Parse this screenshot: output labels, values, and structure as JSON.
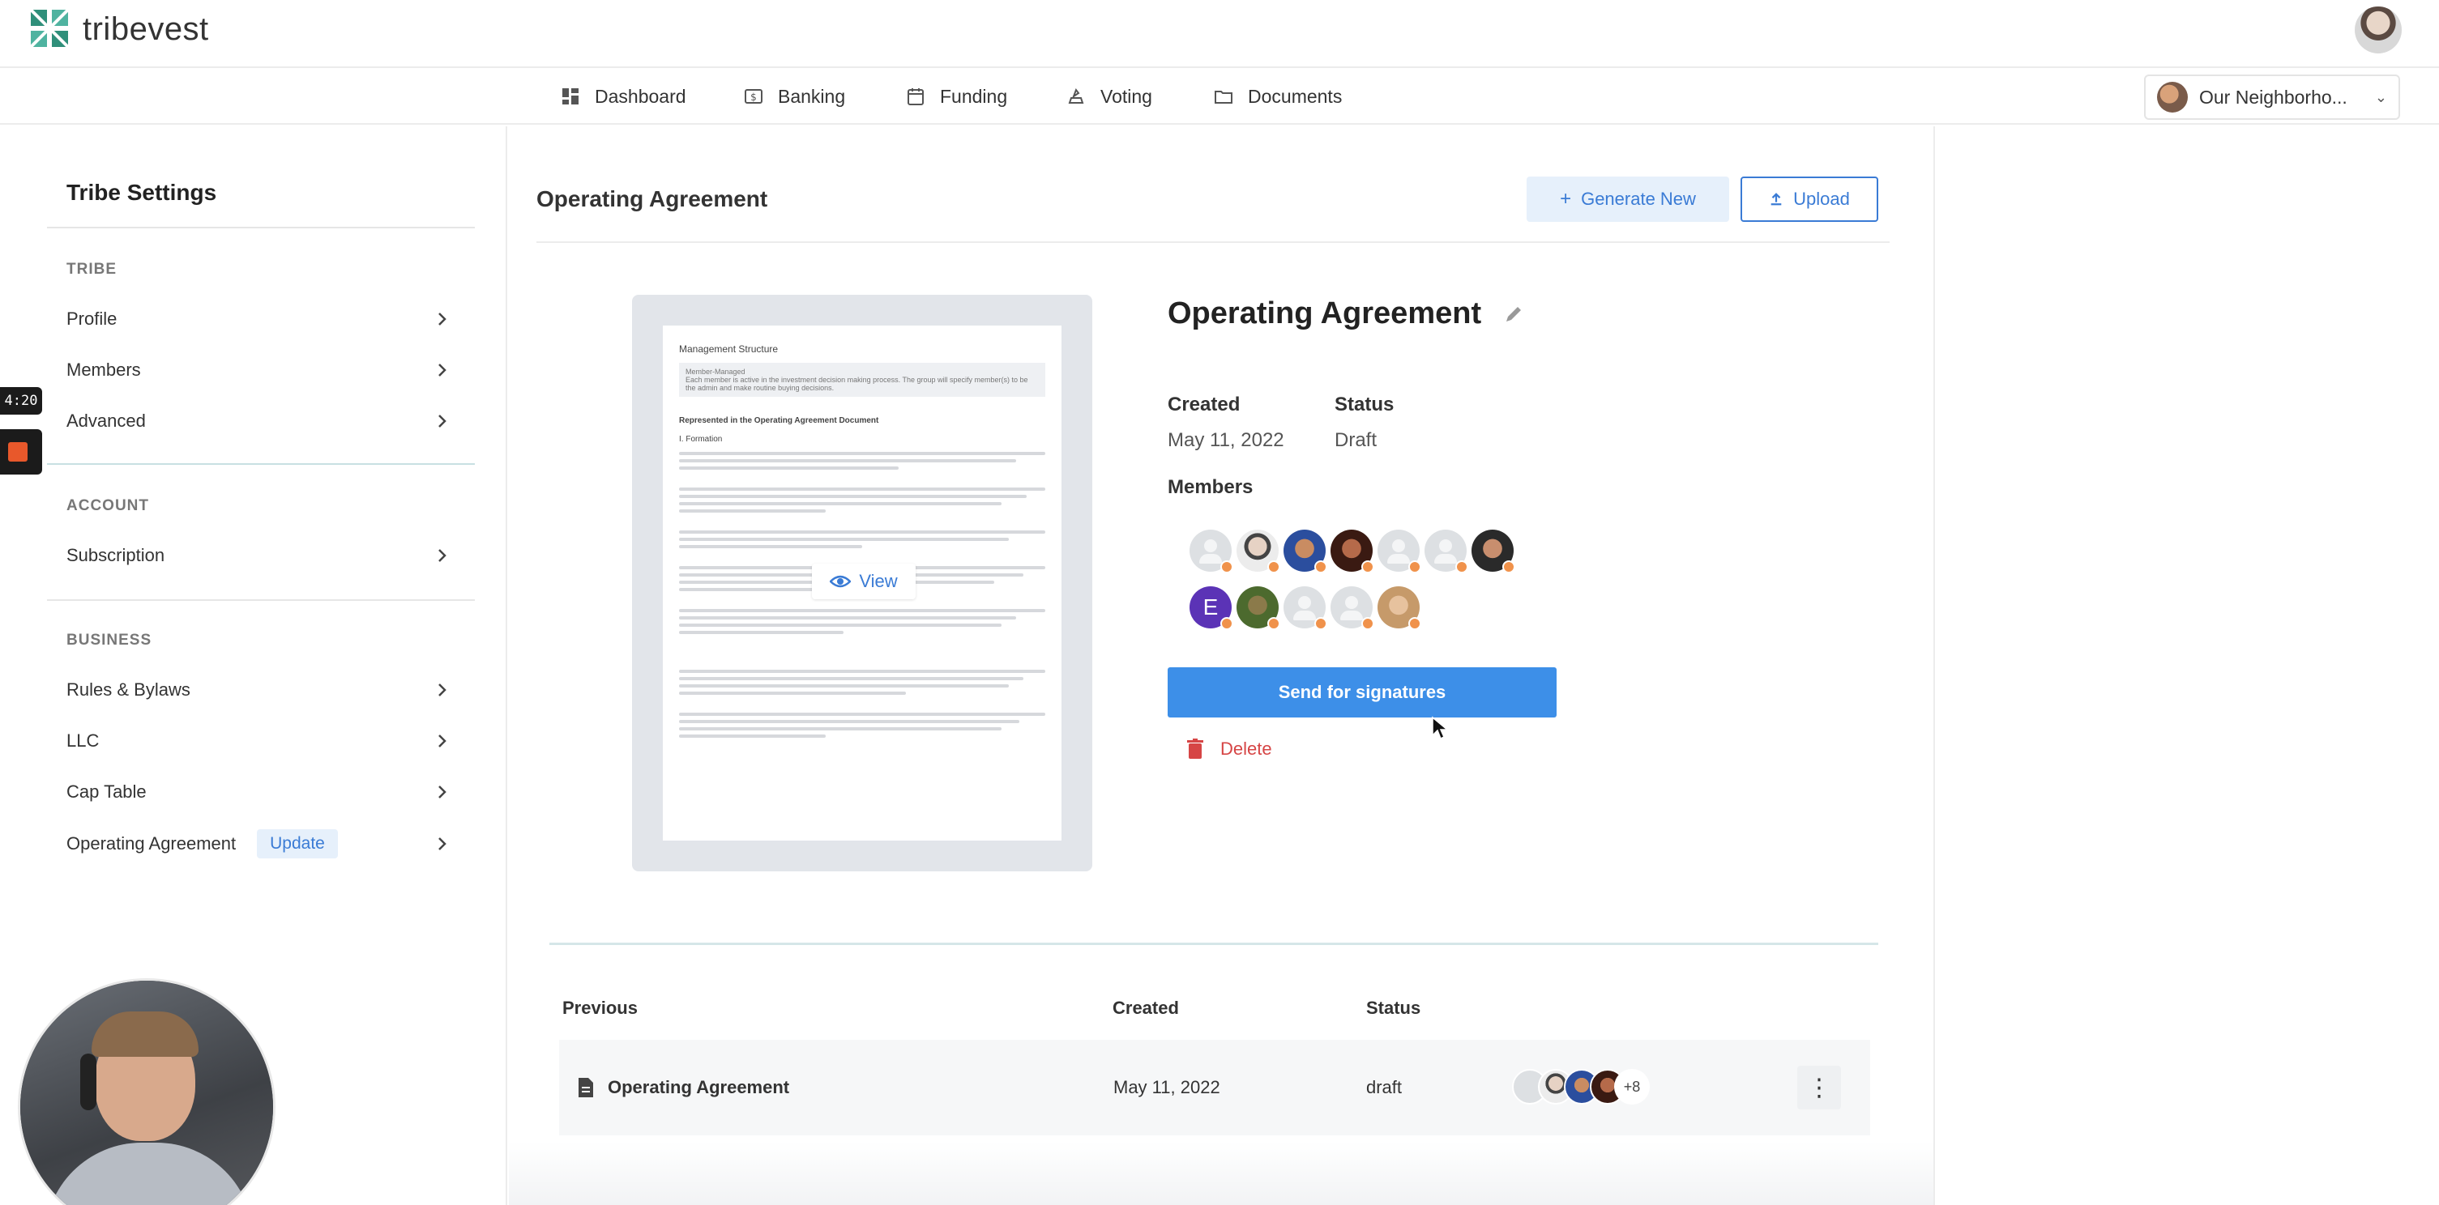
{
  "app": {
    "name": "tribevest",
    "org_selector": "Our Neighborho..."
  },
  "nav": [
    {
      "label": "Dashboard",
      "icon": "dashboard-icon"
    },
    {
      "label": "Banking",
      "icon": "banking-icon"
    },
    {
      "label": "Funding",
      "icon": "funding-icon"
    },
    {
      "label": "Voting",
      "icon": "voting-icon"
    },
    {
      "label": "Documents",
      "icon": "documents-icon"
    }
  ],
  "sidebar": {
    "title": "Tribe Settings",
    "sections": [
      {
        "heading": "TRIBE",
        "items": [
          "Profile",
          "Members",
          "Advanced"
        ]
      },
      {
        "heading": "ACCOUNT",
        "items": [
          "Subscription"
        ]
      },
      {
        "heading": "BUSINESS",
        "items": [
          "Rules & Bylaws",
          "LLC",
          "Cap Table",
          "Operating Agreement"
        ]
      }
    ],
    "update_badge": "Update"
  },
  "recording": {
    "timer": "4:20"
  },
  "main": {
    "title": "Operating Agreement",
    "generate_label": "Generate New",
    "upload_label": "Upload",
    "preview": {
      "heading": "Management Structure",
      "box_title": "Member-Managed",
      "box_text": "Each member is active in the investment decision making process. The group will specify member(s) to be the admin and make routine buying decisions.",
      "subheading": "Represented in the Operating Agreement Document",
      "section": "I. Formation",
      "view_label": "View"
    },
    "detail": {
      "title": "Operating Agreement",
      "created_label": "Created",
      "created_value": "May 11, 2022",
      "status_label": "Status",
      "status_value": "Draft",
      "members_label": "Members",
      "member_letter": "E",
      "send_label": "Send for signatures",
      "delete_label": "Delete"
    },
    "previous": {
      "headers": {
        "name": "Previous",
        "created": "Created",
        "status": "Status"
      },
      "rows": [
        {
          "name": "Operating Agreement",
          "created": "May 11, 2022",
          "status": "draft",
          "more_members": "+8"
        }
      ]
    }
  },
  "colors": {
    "accent": "#3a7bd5",
    "primary_button": "#3d8fe8",
    "delete": "#d64545",
    "status_dot": "#f0924b"
  }
}
